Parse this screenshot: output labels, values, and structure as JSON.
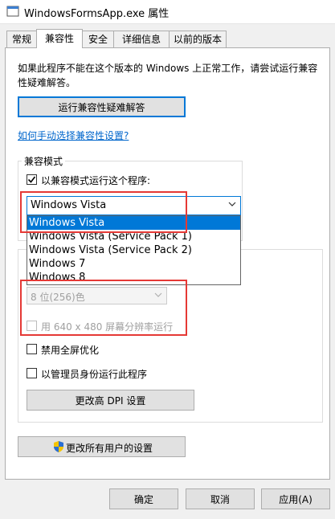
{
  "window": {
    "title": "WindowsFormsApp.exe 属性"
  },
  "tabs": [
    "常规",
    "兼容性",
    "安全",
    "详细信息",
    "以前的版本"
  ],
  "intro_text": "如果此程序不能在这个版本的 Windows 上正常工作，请尝试运行兼容性疑难解答。",
  "troubleshooter_button": "运行兼容性疑难解答",
  "manual_link": "如何手动选择兼容性设置?",
  "compat_mode": {
    "group_label": "兼容模式",
    "checkbox_label": "以兼容模式运行这个程序:",
    "checked": true,
    "selected": "Windows Vista",
    "options": [
      "Windows Vista",
      "Windows Vista (Service Pack 1)",
      "Windows Vista (Service Pack 2)",
      "Windows 7",
      "Windows 8"
    ]
  },
  "settings": {
    "color_mode_value": "8 位(256)色",
    "res_640_label": "用 640 x 480 屏幕分辨率运行",
    "fullscreen_opt_label": "禁用全屏优化",
    "run_as_admin_label": "以管理员身份运行此程序",
    "dpi_button": "更改高 DPI 设置"
  },
  "all_users_button": "更改所有用户的设置",
  "footer": {
    "ok": "确定",
    "cancel": "取消",
    "apply": "应用(A)"
  },
  "colors": {
    "accent": "#0078d7",
    "link": "#0066cc",
    "highlight": "#e53935",
    "shield_blue": "#2a6fd6",
    "shield_yellow": "#f5c400"
  },
  "icons": {
    "app": "app-window-icon",
    "dropdown": "chevron-down-icon",
    "shield": "uac-shield-icon",
    "check": "checkmark-icon"
  }
}
